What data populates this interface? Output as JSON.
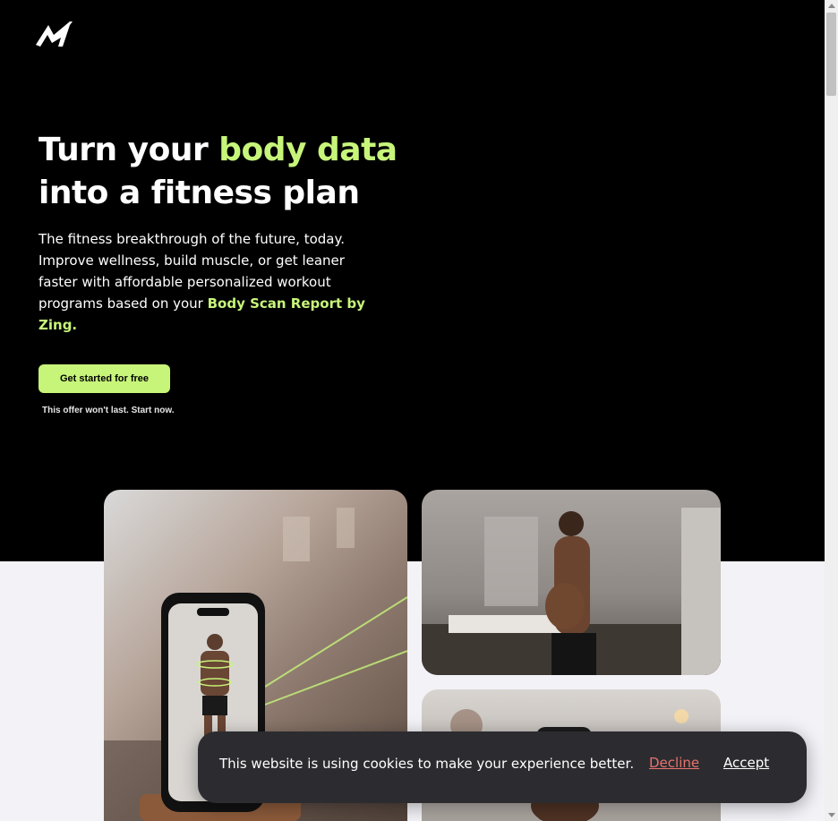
{
  "brand": {
    "logo_icon": "zing-bolt-logo-icon",
    "accent_color": "#c7f57a"
  },
  "hero": {
    "headline_part1": "Turn your ",
    "headline_accent": "body data",
    "headline_part2": "into a fitness plan",
    "subtext_main": "The fitness breakthrough of the future, today. Improve wellness, build muscle, or get leaner faster with affordable personalized workout programs based on your ",
    "subtext_highlight": "Body Scan Report by Zing.",
    "cta_label": "Get started for free",
    "offer_note": "This offer won't last. Start now."
  },
  "cookie_banner": {
    "message": "This website is using cookies to make your experience better.",
    "decline_label": "Decline",
    "accept_label": "Accept",
    "decline_color": "#e8736e"
  }
}
